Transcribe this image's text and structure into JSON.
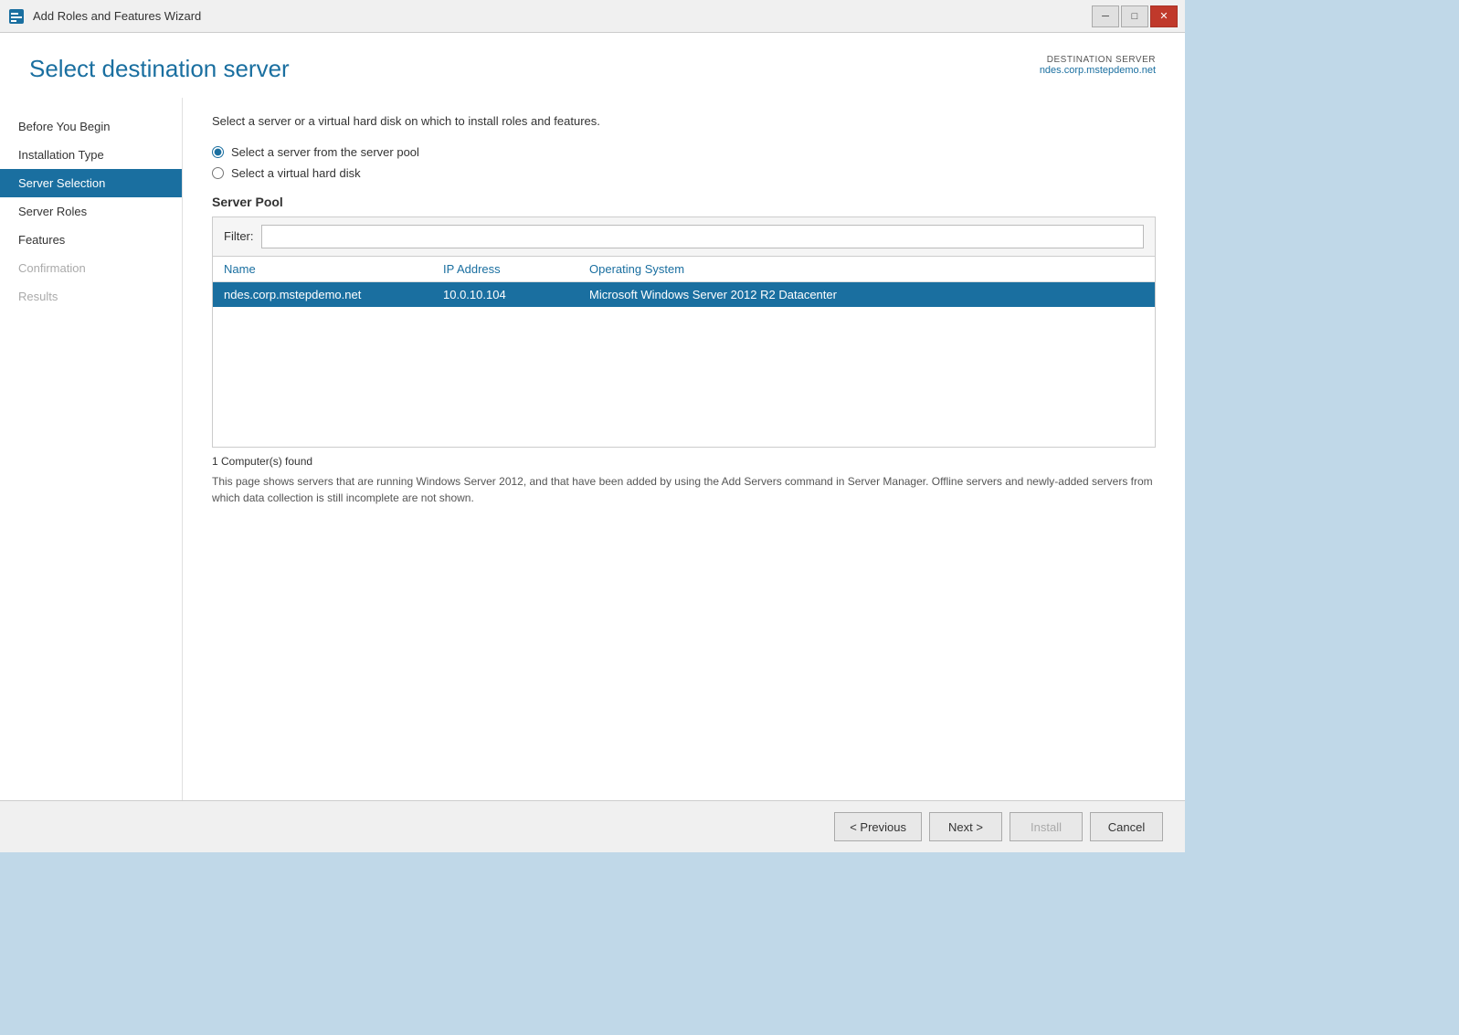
{
  "titlebar": {
    "title": "Add Roles and Features Wizard",
    "icon": "wizard-icon"
  },
  "controls": {
    "minimize": "─",
    "restore": "□",
    "close": "✕"
  },
  "header": {
    "title": "Select destination server",
    "destination_label": "DESTINATION SERVER",
    "destination_name": "ndes.corp.mstepdemo.net"
  },
  "sidebar": {
    "items": [
      {
        "label": "Before You Begin",
        "state": "normal"
      },
      {
        "label": "Installation Type",
        "state": "normal"
      },
      {
        "label": "Server Selection",
        "state": "active"
      },
      {
        "label": "Server Roles",
        "state": "normal"
      },
      {
        "label": "Features",
        "state": "normal"
      },
      {
        "label": "Confirmation",
        "state": "disabled"
      },
      {
        "label": "Results",
        "state": "disabled"
      }
    ]
  },
  "content": {
    "description": "Select a server or a virtual hard disk on which to install roles and features.",
    "radio_options": [
      {
        "id": "pool",
        "label": "Select a server from the server pool",
        "checked": true
      },
      {
        "id": "vhd",
        "label": "Select a virtual hard disk",
        "checked": false
      }
    ],
    "server_pool": {
      "section_title": "Server Pool",
      "filter_label": "Filter:",
      "filter_placeholder": "",
      "table": {
        "columns": [
          {
            "id": "name",
            "label": "Name"
          },
          {
            "id": "ip",
            "label": "IP Address"
          },
          {
            "id": "os",
            "label": "Operating System"
          }
        ],
        "rows": [
          {
            "name": "ndes.corp.mstepdemo.net",
            "ip": "10.0.10.104",
            "os": "Microsoft Windows Server 2012 R2 Datacenter",
            "selected": true
          }
        ]
      },
      "computers_found": "1 Computer(s) found",
      "pool_info": "This page shows servers that are running Windows Server 2012, and that have been added by using the Add Servers command in Server Manager. Offline servers and newly-added servers from which data collection is still incomplete are not shown."
    }
  },
  "footer": {
    "previous_label": "< Previous",
    "next_label": "Next >",
    "install_label": "Install",
    "cancel_label": "Cancel"
  }
}
